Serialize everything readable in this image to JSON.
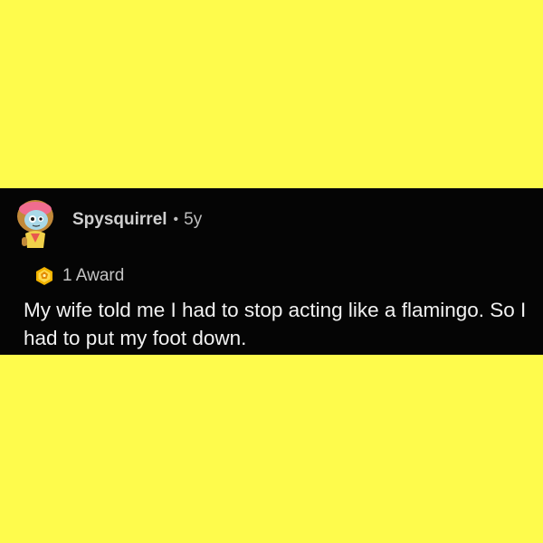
{
  "comment": {
    "username": "Spysquirrel",
    "separator": "•",
    "age": "5y",
    "award_count_label": "1 Award",
    "body": "My wife told me I had to stop acting like a flamingo. So I had to put my foot down."
  },
  "icons": {
    "avatar": "snoo-avatar-icon",
    "award": "award-badge-icon"
  },
  "colors": {
    "background": "#fefb4c",
    "card": "#050505",
    "text": "#f2f2f2",
    "meta_text": "#c9c9c9",
    "award_gold": "#f2b300"
  }
}
